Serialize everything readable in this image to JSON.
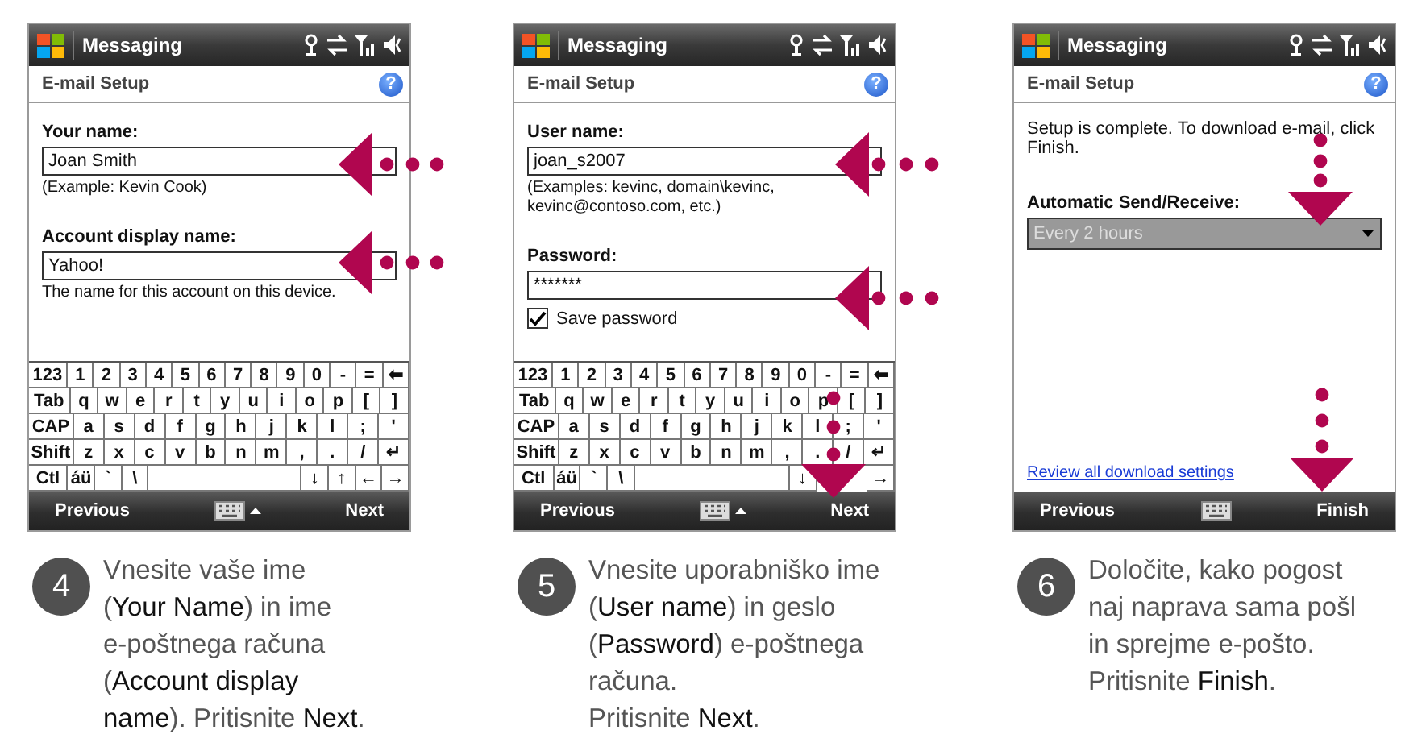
{
  "steps": [
    {
      "screen": {
        "title": "Messaging",
        "header": "E-mail Setup",
        "help": "?",
        "fields": [
          {
            "kind": "label",
            "text": "Your name:"
          },
          {
            "kind": "input",
            "value": "Joan Smith"
          },
          {
            "kind": "hint",
            "text": "(Example: Kevin Cook)"
          },
          {
            "kind": "label",
            "text": "Account display name:"
          },
          {
            "kind": "input",
            "value": "Yahoo!"
          },
          {
            "kind": "hint",
            "text": "The name for this account on this device."
          }
        ],
        "keyboard": [
          [
            "123",
            "1",
            "2",
            "3",
            "4",
            "5",
            "6",
            "7",
            "8",
            "9",
            "0",
            "-",
            "=",
            "⬅"
          ],
          [
            "Tab",
            "q",
            "w",
            "e",
            "r",
            "t",
            "y",
            "u",
            "i",
            "o",
            "p",
            "[",
            "]"
          ],
          [
            "CAP",
            "a",
            "s",
            "d",
            "f",
            "g",
            "h",
            "j",
            "k",
            "l",
            ";",
            "'"
          ],
          [
            "Shift",
            "z",
            "x",
            "c",
            "v",
            "b",
            "n",
            "m",
            ",",
            ".",
            "/",
            "↵"
          ],
          [
            "Ctl",
            "áü",
            "`",
            "\\",
            {
              "kind": "space"
            },
            "↓",
            "↑",
            "←",
            "→"
          ]
        ],
        "softkeys": {
          "left": "Previous",
          "right": "Next",
          "keyboard_caret": true
        }
      },
      "caption": {
        "number": "4",
        "text": "Vnesite vaše ime\n(**Your Name**) in ime\ne-poštnega računa\n(**Account display**\n**name**). Pritisnite **Next**."
      }
    },
    {
      "screen": {
        "title": "Messaging",
        "header": "E-mail Setup",
        "help": "?",
        "fields": [
          {
            "kind": "label",
            "text": "User name:"
          },
          {
            "kind": "input",
            "value": "joan_s2007"
          },
          {
            "kind": "hint",
            "text": "(Examples: kevinc, domain\\kevinc, kevinc@contoso.com, etc.)"
          },
          {
            "kind": "label",
            "text": "Password:"
          },
          {
            "kind": "input",
            "value": "*******"
          },
          {
            "kind": "checkbox",
            "text": "Save password",
            "checked": true
          }
        ],
        "keyboard": [
          [
            "123",
            "1",
            "2",
            "3",
            "4",
            "5",
            "6",
            "7",
            "8",
            "9",
            "0",
            "-",
            "=",
            "⬅"
          ],
          [
            "Tab",
            "q",
            "w",
            "e",
            "r",
            "t",
            "y",
            "u",
            "i",
            "o",
            "p",
            "[",
            "]"
          ],
          [
            "CAP",
            "a",
            "s",
            "d",
            "f",
            "g",
            "h",
            "j",
            "k",
            "l",
            ";",
            "'"
          ],
          [
            "Shift",
            "z",
            "x",
            "c",
            "v",
            "b",
            "n",
            "m",
            ",",
            ".",
            "/",
            "↵"
          ],
          [
            "Ctl",
            "áü",
            "`",
            "\\",
            {
              "kind": "space"
            },
            "↓",
            {
              "kind": "covered"
            },
            {
              "kind": "covered"
            },
            "→"
          ]
        ],
        "softkeys": {
          "left": "Previous",
          "right": "Next",
          "keyboard_caret": true
        }
      },
      "caption": {
        "number": "5",
        "text": "Vnesite uporabniško ime\n(**User name**) in geslo\n(**Password**) e-poštnega\nračuna.\nPritisnite **Next**."
      }
    },
    {
      "screen": {
        "title": "Messaging",
        "header": "E-mail Setup",
        "help": "?",
        "fields": [
          {
            "kind": "text",
            "text": "Setup is complete.  To download e-mail, click Finish."
          },
          {
            "kind": "label",
            "text": "Automatic Send/Receive:"
          },
          {
            "kind": "dropdown",
            "value": "Every 2 hours",
            "disabled": true
          },
          {
            "kind": "link",
            "text": "Review all download settings"
          }
        ],
        "softkeys": {
          "left": "Previous",
          "right": "Finish",
          "keyboard_caret": false
        }
      },
      "caption": {
        "number": "6",
        "text": "Določite, kako pogost\nnaj naprava sama pošl\nin sprejme e-pošto.\nPritisnite **Finish**."
      }
    }
  ]
}
